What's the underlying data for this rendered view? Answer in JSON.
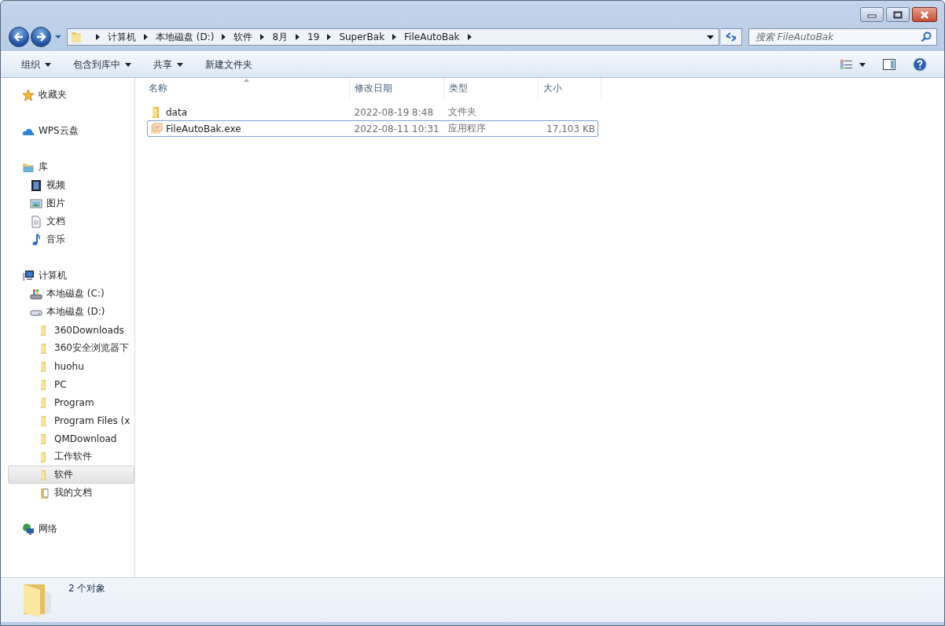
{
  "address_bar": {
    "crumbs": [
      "计算机",
      "本地磁盘 (D:)",
      "软件",
      "8月",
      "19",
      "SuperBak",
      "FileAutoBak"
    ]
  },
  "search": {
    "placeholder": "搜索 FileAutoBak"
  },
  "toolbar": {
    "items": [
      {
        "label": "组织",
        "has_menu": true
      },
      {
        "label": "包含到库中",
        "has_menu": true
      },
      {
        "label": "共享",
        "has_menu": true
      },
      {
        "label": "新建文件夹",
        "has_menu": false
      }
    ]
  },
  "sidebar": {
    "items": [
      {
        "label": "收藏夹",
        "kind": "star",
        "selected": false
      },
      {
        "label": "WPS云盘",
        "kind": "cloud",
        "selected": false
      },
      {
        "label": "库",
        "kind": "library",
        "selected": false,
        "children": [
          {
            "label": "视频",
            "kind": "video",
            "selected": false
          },
          {
            "label": "图片",
            "kind": "picture",
            "selected": false
          },
          {
            "label": "文档",
            "kind": "document",
            "selected": false
          },
          {
            "label": "音乐",
            "kind": "music",
            "selected": false
          }
        ]
      },
      {
        "label": "计算机",
        "kind": "computer",
        "selected": false,
        "children": [
          {
            "label": "本地磁盘 (C:)",
            "kind": "system-drive",
            "selected": false
          },
          {
            "label": "本地磁盘 (D:)",
            "kind": "drive",
            "selected": false,
            "children": [
              {
                "label": "360Downloads",
                "kind": "folder",
                "selected": false
              },
              {
                "label": "360安全浏览器下",
                "kind": "folder",
                "selected": false
              },
              {
                "label": "huohu",
                "kind": "folder",
                "selected": false
              },
              {
                "label": "PC",
                "kind": "folder",
                "selected": false
              },
              {
                "label": "Program",
                "kind": "folder",
                "selected": false
              },
              {
                "label": "Program Files (x",
                "kind": "folder",
                "selected": false
              },
              {
                "label": "QMDownload",
                "kind": "folder",
                "selected": false
              },
              {
                "label": "工作软件",
                "kind": "folder",
                "selected": false
              },
              {
                "label": "软件",
                "kind": "folder",
                "selected": true
              },
              {
                "label": "我的文档",
                "kind": "doc-folder",
                "selected": false
              }
            ]
          }
        ]
      },
      {
        "label": "网络",
        "kind": "network",
        "selected": false
      }
    ]
  },
  "file_list": {
    "columns": [
      "名称",
      "修改日期",
      "类型",
      "大小"
    ],
    "rows": [
      {
        "name": "data",
        "modified": "2022-08-19 8:48",
        "type": "文件夹",
        "size": "",
        "kind": "folder",
        "focused": false
      },
      {
        "name": "FileAutoBak.exe",
        "modified": "2022-08-11 10:31",
        "type": "应用程序",
        "size": "17,103 KB",
        "kind": "app",
        "focused": true
      }
    ]
  },
  "status_bar": {
    "text": "2 个对象"
  }
}
